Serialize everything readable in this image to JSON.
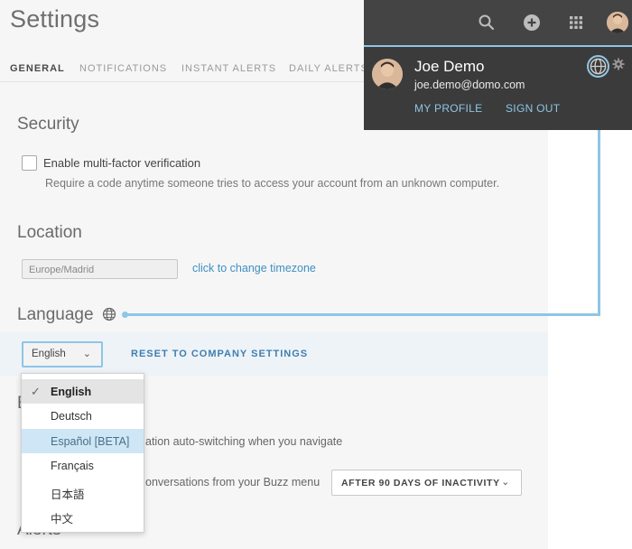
{
  "page": {
    "title": "Settings"
  },
  "tabs": [
    {
      "label": "GENERAL",
      "active": true
    },
    {
      "label": "NOTIFICATIONS"
    },
    {
      "label": "INSTANT ALERTS"
    },
    {
      "label": "DAILY ALERTS"
    }
  ],
  "security": {
    "heading": "Security",
    "mfa_label": "Enable multi-factor verification",
    "mfa_checked": false,
    "mfa_help": "Require a code anytime someone tries to access your account from an unknown computer."
  },
  "location": {
    "heading": "Location",
    "timezone_value": "Europe/Madrid",
    "change_link": "click to change timezone"
  },
  "language": {
    "heading": "Language",
    "selected": "English",
    "reset_label": "RESET TO COMPANY SETTINGS",
    "options": [
      "English",
      "Deutsch",
      "Español [BETA]",
      "Français",
      "日本語",
      "中文"
    ]
  },
  "partial": {
    "hidden_heading_initial": "E",
    "autoswitch_text": "ation auto-switching when you navigate",
    "conversations_text": "onversations from your Buzz menu",
    "inactivity_value": "AFTER 90 DAYS OF INACTIVITY"
  },
  "alerts": {
    "heading": "Alerts"
  },
  "topbar": {
    "icons": [
      "search-icon",
      "plus-icon",
      "apps-grid-icon",
      "avatar"
    ]
  },
  "profile": {
    "name": "Joe Demo",
    "email": "joe.demo@domo.com",
    "my_profile": "MY PROFILE",
    "sign_out": "SIGN OUT"
  },
  "colors": {
    "accent": "#8ec6e6",
    "link": "#3f8fc2",
    "topbar_bg": "#444444",
    "profile_bg": "#3b3b3b",
    "selected_option_bg": "#cfe6f6"
  }
}
